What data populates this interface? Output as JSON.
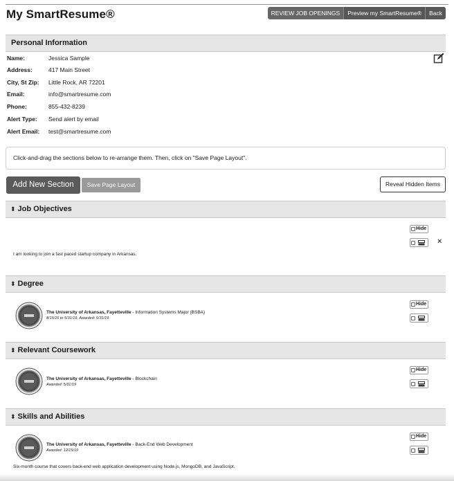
{
  "header": {
    "title": "My SmartResume®",
    "buttons": {
      "review": "REVIEW JOB OPENINGS",
      "preview": "Preview my SmartResume®",
      "back": "Back"
    }
  },
  "personal": {
    "section_title": "Personal Information",
    "rows": [
      {
        "label": "Name:",
        "value": "Jessica Sample"
      },
      {
        "label": "Address:",
        "value": "417 Main Street"
      },
      {
        "label": "City, St Zip:",
        "value": "Little Rock, AR 72201"
      },
      {
        "label": "Email:",
        "value": "info@smartresume.com"
      },
      {
        "label": "Phone:",
        "value": "855-432-8239"
      },
      {
        "label": "Alert Type:",
        "value": "Send alert by email"
      },
      {
        "label": "Alert Email:",
        "value": "test@smartresume.com"
      }
    ]
  },
  "instructions": "Click-and-drag the sections below to re-arrange them. Then, click on \"Save Page Layout\".",
  "actions": {
    "add_section": "Add New Section",
    "save_layout": "Save Page Layout",
    "reveal_hidden": "Reveal Hidden Items"
  },
  "common": {
    "hide_label": "Hide",
    "close_glyph": "×",
    "sort_glyph": "⬍"
  },
  "sections": [
    {
      "title": "Job Objectives",
      "text": "I am looking to join a fast paced startup company in Arkansas."
    },
    {
      "title": "Degree",
      "entry": {
        "institution": "The University of Arkansas, Fayetteville",
        "detail": " - Information Systems Major (BSBA)",
        "dates": "8/15/16 to 5/31/19, Awarded: 5/31/19"
      }
    },
    {
      "title": "Relevant Coursework",
      "entry": {
        "institution": "The University of Arkansas, Fayetteville",
        "detail": " - Blockchain",
        "dates": "Awarded: 5/31/19"
      }
    },
    {
      "title": "Skills and Abilities",
      "entry": {
        "institution": "The University of Arkansas, Fayetteville",
        "detail": " - Back-End Web Development",
        "dates": "Awarded: 12/15/19"
      },
      "text": "Six-month course that covers back-end web application development using Node.js, MongoDB, and JavaScript."
    }
  ]
}
